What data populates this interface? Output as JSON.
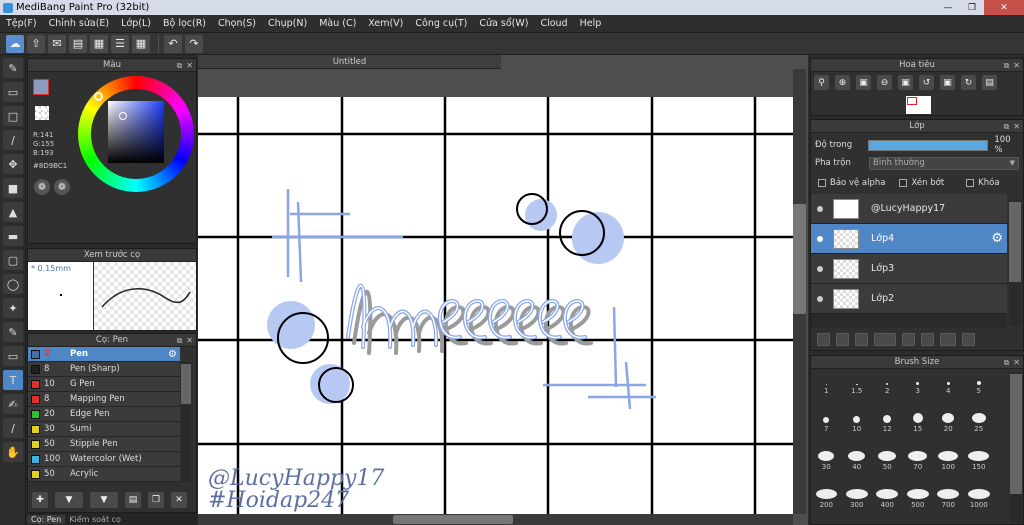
{
  "window": {
    "title": "MediBang Paint Pro (32bit)"
  },
  "menu": [
    "Tệp(F)",
    "Chỉnh sửa(E)",
    "Lớp(L)",
    "Bộ lọc(R)",
    "Chọn(S)",
    "Chụp(N)",
    "Màu (C)",
    "Xem(V)",
    "Công cụ(T)",
    "Cửa sổ(W)",
    "Cloud",
    "Help"
  ],
  "color_panel": {
    "title": "Màu",
    "r": "R:141",
    "g": "G:155",
    "b": "B:193",
    "hex": "#8D9BC1",
    "main_color": "#8d9bc1"
  },
  "preview_panel": {
    "title": "Xem trước cọ",
    "size": "* 0.15mm"
  },
  "brush_panel": {
    "title": "Cọ: Pen",
    "items": [
      {
        "size": "2",
        "name": "Pen",
        "color": "#4a6fa5"
      },
      {
        "size": "8",
        "name": "Pen (Sharp)",
        "color": "#222222"
      },
      {
        "size": "10",
        "name": "G Pen",
        "color": "#e03030"
      },
      {
        "size": "8",
        "name": "Mapping Pen",
        "color": "#e03030"
      },
      {
        "size": "20",
        "name": "Edge Pen",
        "color": "#30c030"
      },
      {
        "size": "30",
        "name": "Sumi",
        "color": "#e0d020"
      },
      {
        "size": "50",
        "name": "Stipple Pen",
        "color": "#e0d020"
      },
      {
        "size": "100",
        "name": "Watercolor (Wet)",
        "color": "#40b0e0"
      },
      {
        "size": "50",
        "name": "Acrylic",
        "color": "#e0d020"
      }
    ]
  },
  "bottom_tabs": [
    "Cọ: Pen",
    "Kiểm soát cọ"
  ],
  "document": {
    "tab": "Untitled",
    "watermark1": "@LucyHappy17",
    "watermark2": "#Hoidap247",
    "drawn_text": "hmeeee"
  },
  "navigator": {
    "title": "Hoa tiêu"
  },
  "layer_panel": {
    "title": "Lớp",
    "opacity_label": "Độ trong",
    "opacity_value": "100 %",
    "opacity": 100,
    "blend_label": "Pha trộn",
    "blend_value": "Bình thường",
    "protect_alpha": "Bảo vệ alpha",
    "clipping": "Xén bớt",
    "lock": "Khóa",
    "layers": [
      {
        "name": "@LucyHappy17",
        "selected": false
      },
      {
        "name": "Lớp4",
        "selected": true
      },
      {
        "name": "Lớp3",
        "selected": false
      },
      {
        "name": "Lớp2",
        "selected": false
      }
    ]
  },
  "brush_size_panel": {
    "title": "Brush Size",
    "sizes": [
      "1",
      "1.5",
      "2",
      "3",
      "4",
      "5",
      "7",
      "10",
      "12",
      "15",
      "20",
      "25",
      "30",
      "40",
      "50",
      "70",
      "100",
      "150",
      "200",
      "300",
      "400",
      "500",
      "700",
      "1000"
    ]
  }
}
